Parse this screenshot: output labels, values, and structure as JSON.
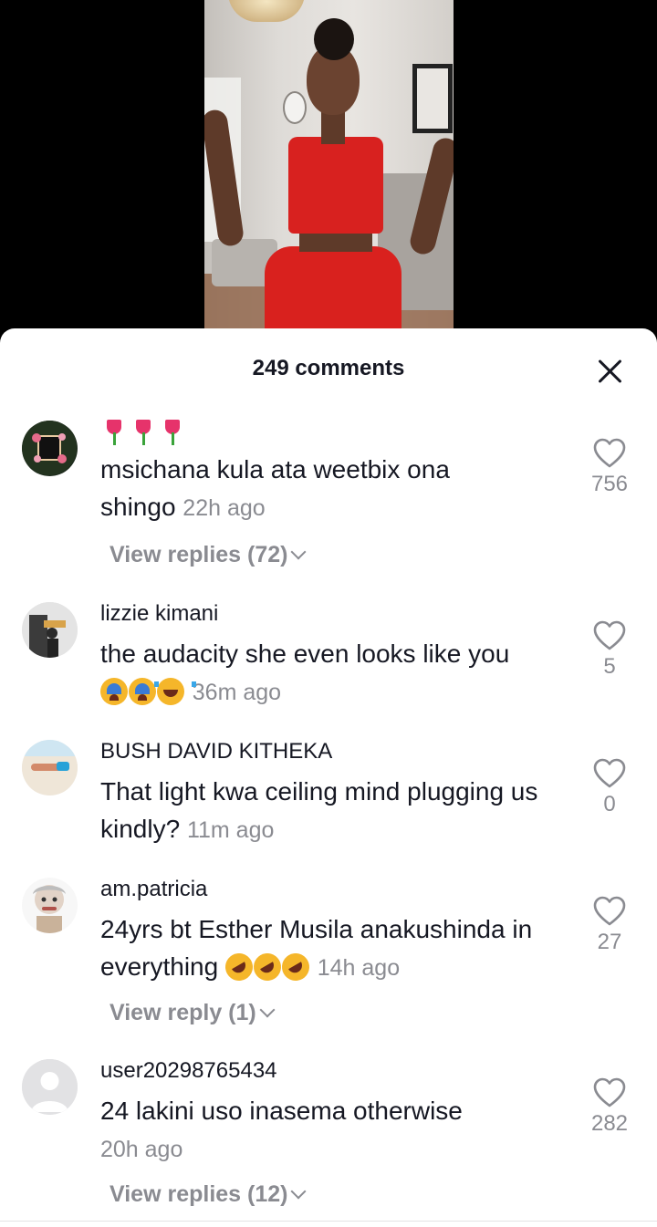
{
  "header": {
    "comment_count_label": "249 comments"
  },
  "comments": [
    {
      "username": "",
      "prefix_emoji": [
        "tulip",
        "tulip",
        "tulip"
      ],
      "text": "msichana kula ata weetbix ona shingo",
      "time": "22h ago",
      "likes": "756",
      "replies": "View replies (72)"
    },
    {
      "username": "lizzie kimani",
      "text": "the audacity she even looks like you",
      "suffix_emoji": [
        "loudly-crying-face",
        "loudly-crying-face",
        "face-with-tears-of-joy"
      ],
      "time": "36m ago",
      "likes": "5",
      "replies": ""
    },
    {
      "username": "BUSH DAVID KITHEKA",
      "text": "That light kwa ceiling mind plugging us kindly?",
      "time": "11m ago",
      "likes": "0",
      "replies": ""
    },
    {
      "username": "am.patricia",
      "text": "24yrs bt Esther Musila anakushinda in everything",
      "suffix_emoji": [
        "rolling-on-floor-laughing",
        "rolling-on-floor-laughing",
        "rolling-on-floor-laughing"
      ],
      "time": "14h ago",
      "likes": "27",
      "replies": "View reply (1)"
    },
    {
      "username": "user20298765434",
      "text": "24 lakini uso inasema otherwise",
      "time": "20h ago",
      "likes": "282",
      "replies": "View replies (12)"
    }
  ],
  "icons": {
    "like": "heart-outline-icon",
    "close": "close-x-icon",
    "expand": "chevron-down-icon"
  },
  "colors": {
    "text": "#161823",
    "muted": "#8a8b91",
    "background": "#ffffff"
  }
}
